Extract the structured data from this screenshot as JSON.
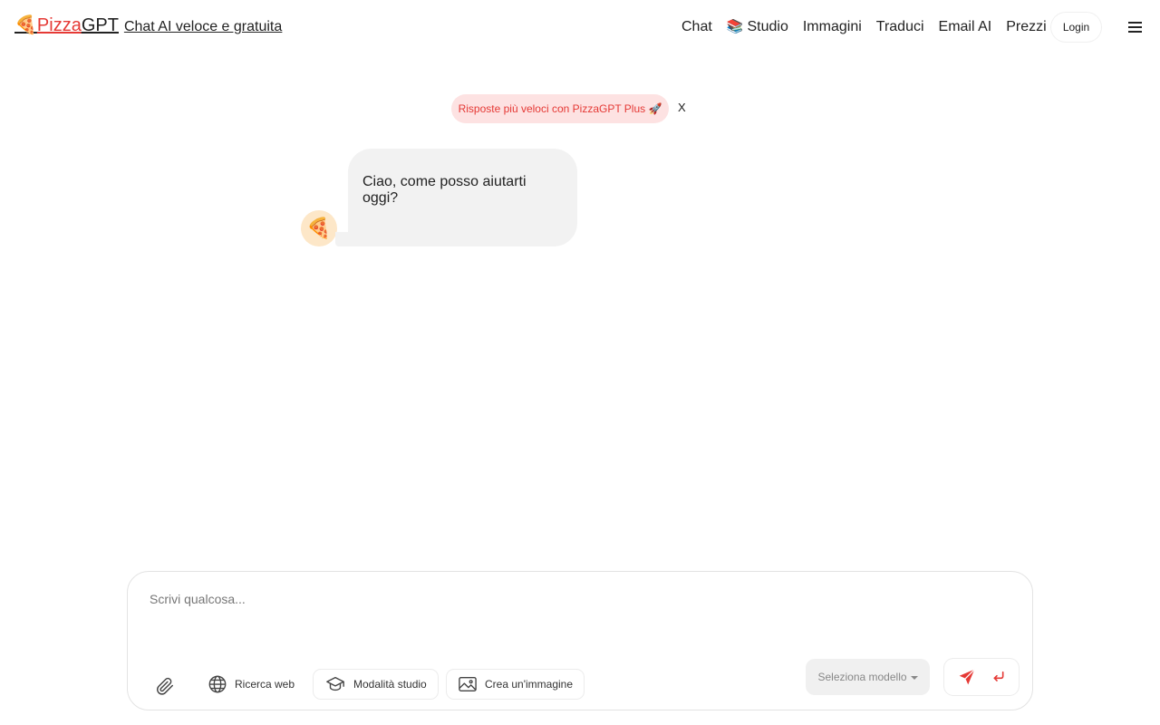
{
  "header": {
    "brand": {
      "icon": "🍕",
      "pizza": "Pizza",
      "gpt": "GPT",
      "tagline": "Chat AI veloce e gratuita"
    },
    "nav": [
      {
        "label": "Chat",
        "emoji": ""
      },
      {
        "label": "Studio",
        "emoji": "📚"
      },
      {
        "label": "Immagini",
        "emoji": ""
      },
      {
        "label": "Traduci",
        "emoji": ""
      },
      {
        "label": "Email AI",
        "emoji": ""
      },
      {
        "label": "Prezzi",
        "emoji": ""
      }
    ],
    "login_label": "Login",
    "menu_icon": "hamburger-menu-icon"
  },
  "promo": {
    "text": "Risposte più veloci con PizzaGPT Plus 🚀",
    "close_label": "X"
  },
  "chat": {
    "messages": [
      {
        "role": "assistant",
        "avatar": "🍕",
        "text": "Ciao, come posso aiutarti oggi?"
      }
    ]
  },
  "composer": {
    "placeholder": "Scrivi qualcosa...",
    "tools": {
      "web_search": "Ricerca web",
      "study_mode": "Modalità studio",
      "create_image": "Crea un'immagine"
    },
    "model_select": "Seleziona modello",
    "icons": [
      "paperclip-icon",
      "globe-icon",
      "graduation-cap-icon",
      "image-icon",
      "send-icon",
      "enter-icon"
    ]
  },
  "colors": {
    "accent": "#e53935",
    "promo_bg": "#fde2e2",
    "bubble_bg": "#f2f2f2"
  }
}
